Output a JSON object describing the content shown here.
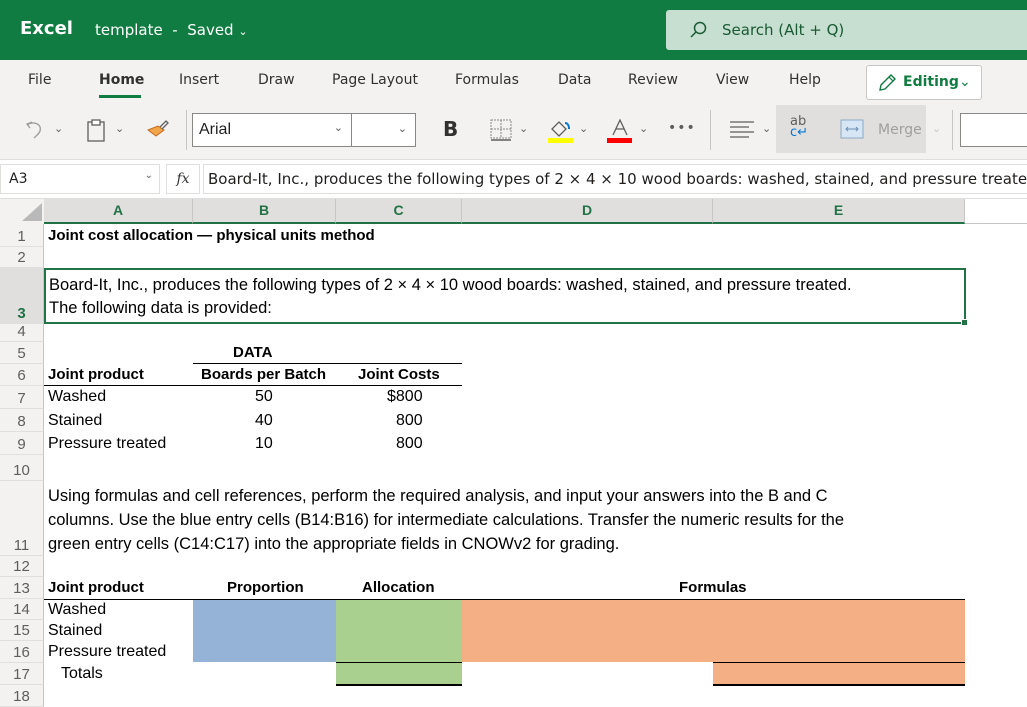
{
  "app": {
    "name": "Excel",
    "document_title": "template",
    "save_status": "Saved",
    "search_placeholder": "Search (Alt + Q)"
  },
  "ribbon": {
    "tabs": [
      {
        "label": "File",
        "active": false
      },
      {
        "label": "Home",
        "active": true
      },
      {
        "label": "Insert",
        "active": false
      },
      {
        "label": "Draw",
        "active": false
      },
      {
        "label": "Page Layout",
        "active": false
      },
      {
        "label": "Formulas",
        "active": false
      },
      {
        "label": "Data",
        "active": false
      },
      {
        "label": "Review",
        "active": false
      },
      {
        "label": "View",
        "active": false
      },
      {
        "label": "Help",
        "active": false
      }
    ],
    "mode_button": "Editing",
    "font_name": "Arial",
    "font_size": "",
    "bold_label": "B",
    "merge_label": "Merge",
    "fill_color": "#ffff00",
    "font_color": "#ff0000",
    "more_label": "•••"
  },
  "formula_bar": {
    "name_box": "A3",
    "fx_label": "fx",
    "formula": "Board-It, Inc., produces the following types of 2 × 4 × 10 wood boards: washed, stained, and pressure treated. The following data is provided:"
  },
  "sheet": {
    "columns": [
      "A",
      "B",
      "C",
      "D",
      "E"
    ],
    "rows": [
      "1",
      "2",
      "3",
      "4",
      "5",
      "6",
      "7",
      "8",
      "9",
      "10",
      "11",
      "12",
      "13",
      "14",
      "15",
      "16",
      "17",
      "18"
    ],
    "selected_cell": "A3",
    "title": "Joint cost allocation — physical units method",
    "intro_line1": "Board-It, Inc., produces the following types of 2 × 4 × 10 wood boards: washed, stained, and pressure treated.",
    "intro_line2": "The following data is provided:",
    "data_table": {
      "heading": "DATA",
      "headers": [
        "Joint product",
        "Boards per Batch",
        "Joint Costs"
      ],
      "rows": [
        [
          "Washed",
          "50",
          "$800"
        ],
        [
          "Stained",
          "40",
          "800"
        ],
        [
          "Pressure treated",
          "10",
          "800"
        ]
      ]
    },
    "instructions": [
      "Using formulas and cell references, perform the required analysis, and input your answers into the B and C",
      "columns. Use the blue entry cells (B14:B16) for intermediate calculations. Transfer the numeric results for the",
      "green entry cells (C14:C17) into the appropriate fields in CNOWv2 for grading."
    ],
    "answer_table": {
      "headers": [
        "Joint product",
        "Proportion",
        "Allocation",
        "Formulas"
      ],
      "rows": [
        "Washed",
        "Stained",
        "Pressure treated"
      ],
      "totals_label": "Totals"
    },
    "entry_colors": {
      "blue": "#95b3d7",
      "green": "#a9d08e",
      "orange": "#f4b084"
    }
  }
}
